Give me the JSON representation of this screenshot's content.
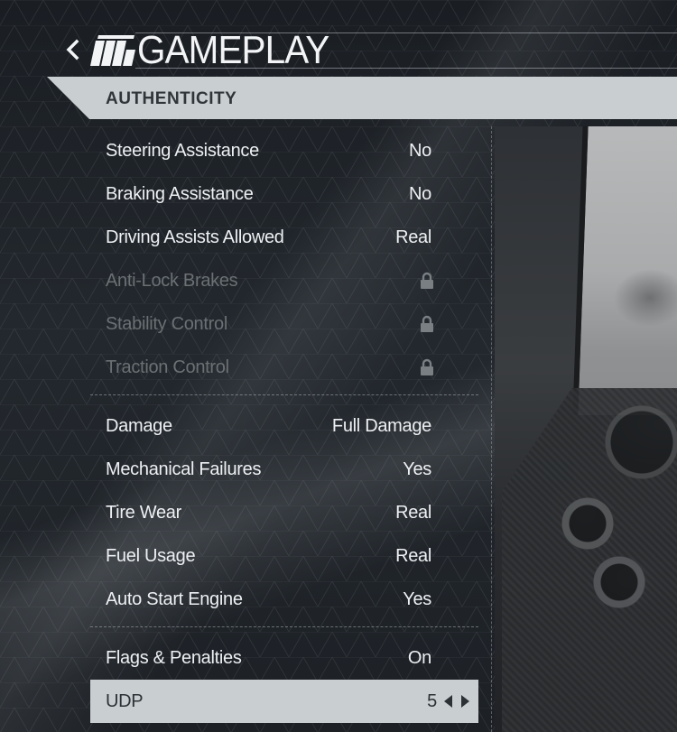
{
  "header": {
    "title": "GAMEPLAY",
    "back_icon": "chevron-left-icon",
    "logo_icon": "striped-logo-icon"
  },
  "section": {
    "label": "AUTHENTICITY"
  },
  "settings": {
    "group1": [
      {
        "label": "Steering Assistance",
        "value": "No",
        "locked": false
      },
      {
        "label": "Braking Assistance",
        "value": "No",
        "locked": false
      },
      {
        "label": "Driving Assists Allowed",
        "value": "Real",
        "locked": false
      },
      {
        "label": "Anti-Lock Brakes",
        "value": "",
        "locked": true
      },
      {
        "label": "Stability Control",
        "value": "",
        "locked": true
      },
      {
        "label": "Traction Control",
        "value": "",
        "locked": true
      }
    ],
    "group2": [
      {
        "label": "Damage",
        "value": "Full Damage"
      },
      {
        "label": "Mechanical Failures",
        "value": "Yes"
      },
      {
        "label": "Tire Wear",
        "value": "Real"
      },
      {
        "label": "Fuel Usage",
        "value": "Real"
      },
      {
        "label": "Auto Start Engine",
        "value": "Yes"
      }
    ],
    "group3": [
      {
        "label": "Flags & Penalties",
        "value": "On"
      },
      {
        "label": "UDP",
        "value": "5",
        "selected": true
      }
    ]
  },
  "colors": {
    "tab_bg": "#c9ced1",
    "text_primary": "#eef1f3",
    "text_locked": "#6b7074",
    "tab_text": "#30353a"
  }
}
